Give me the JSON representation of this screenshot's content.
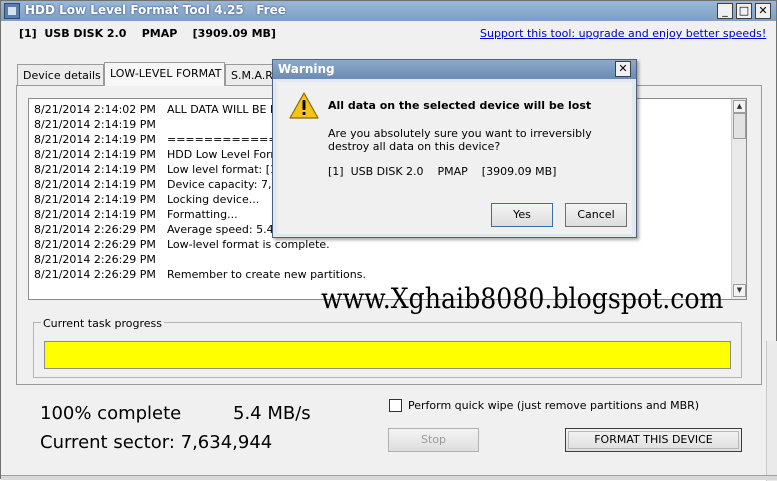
{
  "window": {
    "title": "HDD Low Level Format Tool 4.25   Free",
    "minimize_label": "_",
    "maximize_label": "□",
    "close_label": "✕"
  },
  "device_bar": {
    "device": "[1]  USB DISK 2.0    PMAP    [3909.09 MB]",
    "support_link": "Support this tool: upgrade and enjoy better speeds!"
  },
  "tabs": [
    {
      "label": "Device details"
    },
    {
      "label": "LOW-LEVEL FORMAT"
    },
    {
      "label": "S.M.A.R"
    }
  ],
  "log": [
    {
      "time": "8/21/2014 2:14:02 PM",
      "message": "ALL DATA WILL BE FU"
    },
    {
      "time": "8/21/2014 2:14:19 PM",
      "message": ""
    },
    {
      "time": "8/21/2014 2:14:19 PM",
      "message": "======================"
    },
    {
      "time": "8/21/2014 2:14:19 PM",
      "message": "HDD Low Level Form"
    },
    {
      "time": "8/21/2014 2:14:19 PM",
      "message": "Low level format: [1"
    },
    {
      "time": "8/21/2014 2:14:19 PM",
      "message": "Device capacity: 7,6"
    },
    {
      "time": "8/21/2014 2:14:19 PM",
      "message": "Locking device..."
    },
    {
      "time": "8/21/2014 2:14:19 PM",
      "message": "Formatting..."
    },
    {
      "time": "8/21/2014 2:26:29 PM",
      "message": "Average speed: 5.4"
    },
    {
      "time": "8/21/2014 2:26:29 PM",
      "message": "Low-level format is complete."
    },
    {
      "time": "8/21/2014 2:26:29 PM",
      "message": ""
    },
    {
      "time": "8/21/2014 2:26:29 PM",
      "message": "Remember to create new partitions."
    }
  ],
  "watermark": "www.Xghaib8080.blogspot.com",
  "progress": {
    "title": "Current task progress",
    "fraction": 1.0,
    "percent_text": "100% complete",
    "speed_text": "5.4 MB/s",
    "sector_text": "Current sector: 7,634,944",
    "color": "#ffff00"
  },
  "options": {
    "quick_wipe_label": "Perform quick wipe (just remove partitions and MBR)",
    "quick_wipe_checked": false
  },
  "buttons": {
    "stop": "Stop",
    "format": "FORMAT THIS DEVICE"
  },
  "dialog": {
    "title": "Warning",
    "close_label": "✕",
    "icon": "warning-icon",
    "heading": "All data on the selected device will be lost",
    "message": "Are you absolutely sure you want to irreversibly destroy all data on this device?",
    "device": "[1]  USB DISK 2.0    PMAP    [3909.09 MB]",
    "yes": "Yes",
    "cancel": "Cancel"
  }
}
